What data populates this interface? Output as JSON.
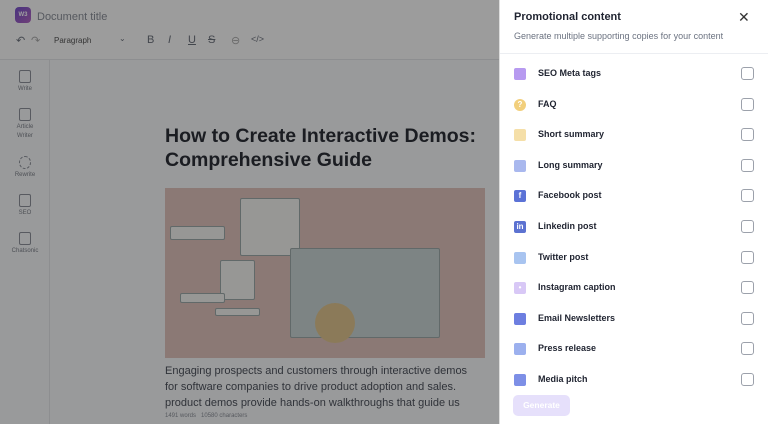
{
  "editor": {
    "doc_title": "Document title",
    "logo_text": "W3",
    "toolbar": {
      "block_type": "Paragraph",
      "bold": "B",
      "italic": "I",
      "underline": "U",
      "strike": "S",
      "link": "⊖",
      "code": "</>",
      "undo": "↶",
      "redo": "↷"
    },
    "sidebar": [
      {
        "label": "Write"
      },
      {
        "label": "Article Writer"
      },
      {
        "label": "Rewrite"
      },
      {
        "label": "SEO"
      },
      {
        "label": "Chatsonic"
      }
    ],
    "article_title_1": "How to Create Interactive Demos:",
    "article_title_2": "Comprehensive Guide",
    "paragraph": [
      "Engaging prospects and customers through interactive demos",
      "for software companies to drive product adoption and sales. ",
      "product demos provide hands-on walkthroughs that guide us"
    ],
    "word_count": "1491 words",
    "char_count": "10580 characters"
  },
  "panel": {
    "title": "Promotional content",
    "subtitle": "Generate multiple supporting copies for your content",
    "close": "✕",
    "items": [
      {
        "label": "SEO Meta tags",
        "icon": "seo-meta-icon",
        "color": "#b79af0"
      },
      {
        "label": "FAQ",
        "icon": "faq-icon",
        "color": "#f2cf7c"
      },
      {
        "label": "Short summary",
        "icon": "short-summary-icon",
        "color": "#f5dfa8"
      },
      {
        "label": "Long summary",
        "icon": "long-summary-icon",
        "color": "#a9b8ee"
      },
      {
        "label": "Facebook post",
        "icon": "facebook-icon",
        "color": "#5b72d6"
      },
      {
        "label": "Linkedin post",
        "icon": "linkedin-icon",
        "color": "#5c72d1"
      },
      {
        "label": "Twitter post",
        "icon": "twitter-icon",
        "color": "#a8c4f0"
      },
      {
        "label": "Instagram caption",
        "icon": "instagram-icon",
        "color": "#d8c8f6"
      },
      {
        "label": "Email Newsletters",
        "icon": "email-icon",
        "color": "#6d7ee0"
      },
      {
        "label": "Press release",
        "icon": "press-release-icon",
        "color": "#9cb0ee"
      },
      {
        "label": "Media pitch",
        "icon": "media-pitch-icon",
        "color": "#7d8fe6"
      }
    ],
    "generate": "Generate"
  }
}
